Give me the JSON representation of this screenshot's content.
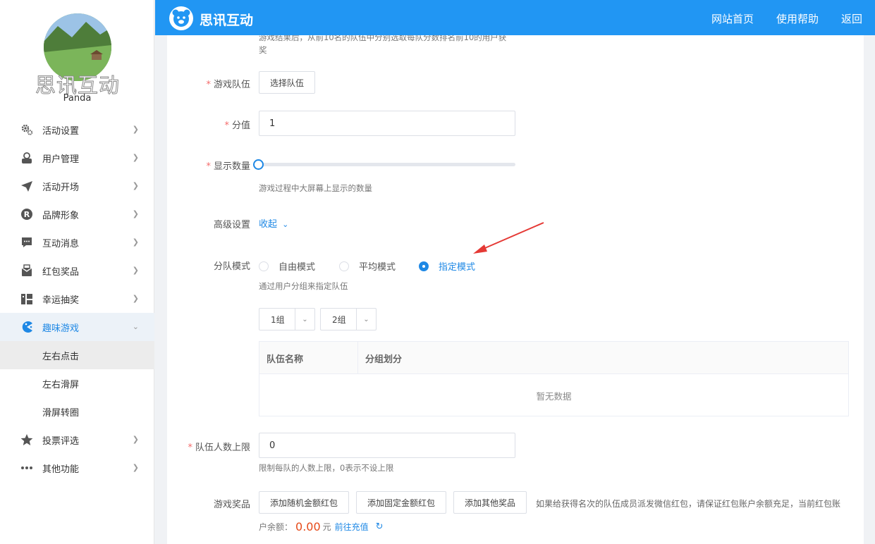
{
  "sidebar": {
    "brand_overlay": "思讯互动",
    "username": "Panda",
    "menu": [
      {
        "label": "活动设置",
        "icon": "gears-icon"
      },
      {
        "label": "用户管理",
        "icon": "user-icon"
      },
      {
        "label": "活动开场",
        "icon": "paper-plane-icon"
      },
      {
        "label": "品牌形象",
        "icon": "registered-icon"
      },
      {
        "label": "互动消息",
        "icon": "message-icon"
      },
      {
        "label": "红包奖品",
        "icon": "gift-box-icon"
      },
      {
        "label": "幸运抽奖",
        "icon": "lottery-icon"
      },
      {
        "label": "趣味游戏",
        "icon": "pacman-icon"
      },
      {
        "label": "投票评选",
        "icon": "star-icon"
      },
      {
        "label": "其他功能",
        "icon": "more-dots-icon"
      }
    ],
    "submenu": [
      "左右点击",
      "左右滑屏",
      "滑屏转圈"
    ]
  },
  "topbar": {
    "logo_text": "思讯互动",
    "nav": [
      "网站首页",
      "使用帮助",
      "返回"
    ]
  },
  "form": {
    "top_hint_line1": "游戏结果后，从前10名的队伍中分别选取每队分数排名前10的用户获",
    "top_hint_line2": "奖",
    "team": {
      "label": "游戏队伍",
      "button": "选择队伍"
    },
    "score": {
      "label": "分值",
      "value": "1"
    },
    "display_count": {
      "label": "显示数量",
      "hint": "游戏过程中大屏幕上显示的数量",
      "level": 0
    },
    "advanced": {
      "label": "高级设置",
      "toggle": "收起"
    },
    "team_mode": {
      "label": "分队模式",
      "options": [
        "自由模式",
        "平均模式",
        "指定模式"
      ],
      "selected": "指定模式",
      "hint": "通过用户分组来指定队伍"
    },
    "group_selects": [
      "1组",
      "2组"
    ],
    "table": {
      "columns": [
        "队伍名称",
        "分组划分"
      ],
      "empty_text": "暂无数据"
    },
    "team_limit": {
      "label": "队伍人数上限",
      "value": "0",
      "hint": "限制每队的人数上限，0表示不设上限"
    },
    "prizes": {
      "label": "游戏奖品",
      "buttons": [
        "添加随机金额红包",
        "添加固定金额红包",
        "添加其他奖品"
      ],
      "note": "如果给获得名次的队伍成员派发微信红包，请保证红包账户余额充足，当前红包账",
      "balance_label": "户余额：",
      "balance_value": "0.00",
      "balance_unit": "元",
      "recharge_link": "前往充值"
    }
  },
  "colors": {
    "primary": "#2196f3",
    "link": "#1e88e5",
    "required": "#f56c6c",
    "balance": "#e64a19",
    "arrow": "#e53935"
  }
}
